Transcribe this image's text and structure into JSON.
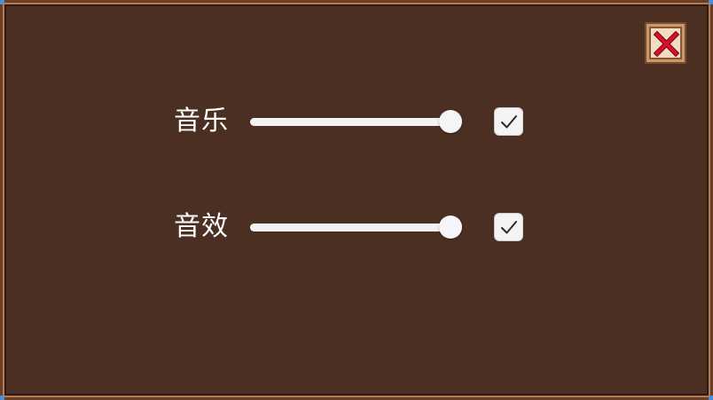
{
  "window": {
    "close_icon": "close-x-icon"
  },
  "settings": [
    {
      "label": "音乐",
      "volume": 1.0,
      "enabled": true,
      "slider_icon": "slider",
      "checkbox_icon": "checkmark-icon"
    },
    {
      "label": "音效",
      "volume": 1.0,
      "enabled": true,
      "slider_icon": "slider",
      "checkbox_icon": "checkmark-icon"
    }
  ],
  "colors": {
    "panel_background": "#4b2f22",
    "close_x": "#d4102a",
    "label_text": "#ffffff"
  }
}
